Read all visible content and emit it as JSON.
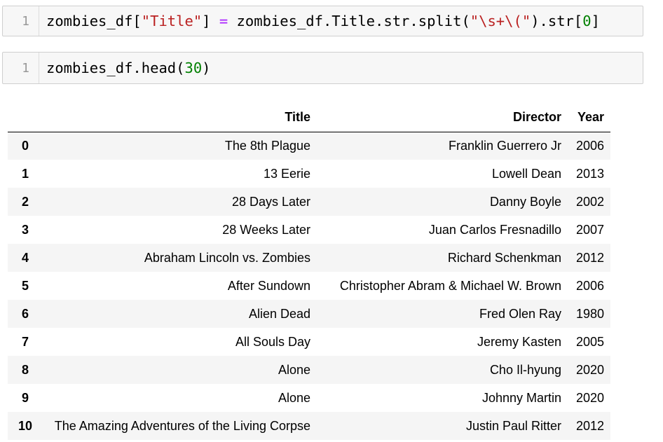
{
  "cells": [
    {
      "prompt": "1",
      "tokens": [
        {
          "text": "zombies_df[",
          "cls": ""
        },
        {
          "text": "\"Title\"",
          "cls": "tok-str"
        },
        {
          "text": "] ",
          "cls": ""
        },
        {
          "text": "=",
          "cls": "tok-op"
        },
        {
          "text": " zombies_df.Title.str.split(",
          "cls": ""
        },
        {
          "text": "\"\\s+\\(\"",
          "cls": "tok-str"
        },
        {
          "text": ").str[",
          "cls": ""
        },
        {
          "text": "0",
          "cls": "tok-num"
        },
        {
          "text": "]",
          "cls": ""
        }
      ]
    },
    {
      "prompt": "1",
      "tokens": [
        {
          "text": "zombies_df.head(",
          "cls": ""
        },
        {
          "text": "30",
          "cls": "tok-num"
        },
        {
          "text": ")",
          "cls": ""
        }
      ]
    }
  ],
  "table": {
    "columns": [
      "",
      "Title",
      "Director",
      "Year"
    ],
    "rows": [
      {
        "index": "0",
        "title": "The 8th Plague",
        "director": "Franklin Guerrero Jr",
        "year": "2006"
      },
      {
        "index": "1",
        "title": "13 Eerie",
        "director": "Lowell Dean",
        "year": "2013"
      },
      {
        "index": "2",
        "title": "28 Days Later",
        "director": "Danny Boyle",
        "year": "2002"
      },
      {
        "index": "3",
        "title": "28 Weeks Later",
        "director": "Juan Carlos Fresnadillo",
        "year": "2007"
      },
      {
        "index": "4",
        "title": "Abraham Lincoln vs. Zombies",
        "director": "Richard Schenkman",
        "year": "2012"
      },
      {
        "index": "5",
        "title": "After Sundown",
        "director": "Christopher Abram & Michael W. Brown",
        "year": "2006"
      },
      {
        "index": "6",
        "title": "Alien Dead",
        "director": "Fred Olen Ray",
        "year": "1980"
      },
      {
        "index": "7",
        "title": "All Souls Day",
        "director": "Jeremy Kasten",
        "year": "2005"
      },
      {
        "index": "8",
        "title": "Alone",
        "director": "Cho Il-hyung",
        "year": "2020"
      },
      {
        "index": "9",
        "title": "Alone",
        "director": "Johnny Martin",
        "year": "2020"
      },
      {
        "index": "10",
        "title": "The Amazing Adventures of the Living Corpse",
        "director": "Justin Paul Ritter",
        "year": "2012"
      }
    ]
  },
  "colors": {
    "string": "#ba2121",
    "operator": "#aa22ff",
    "number": "#008000",
    "cell_bg": "#f7f7f7",
    "row_stripe": "#f5f5f5"
  }
}
